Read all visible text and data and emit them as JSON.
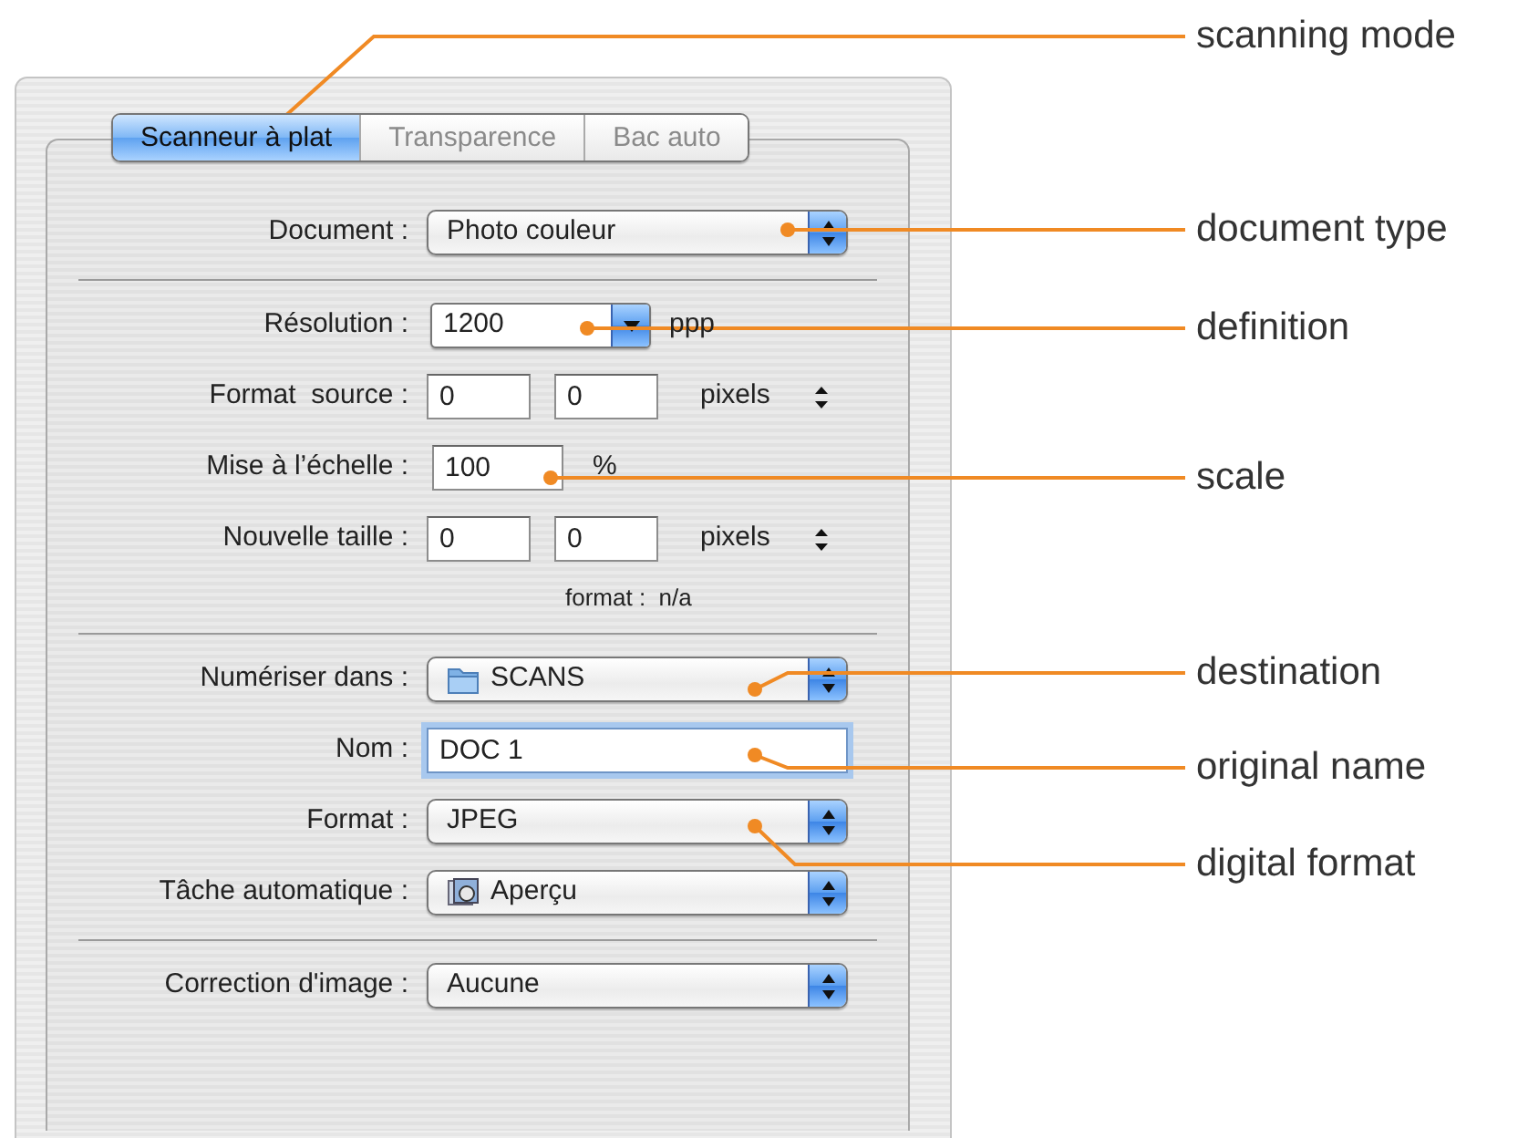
{
  "tabs": [
    {
      "label": "Scanneur à plat",
      "selected": true
    },
    {
      "label": "Transparence",
      "selected": false
    },
    {
      "label": "Bac auto",
      "selected": false
    }
  ],
  "rows": [
    {
      "kind": "popup",
      "label": "Document :",
      "value": "Photo couleur"
    },
    {
      "kind": "separator"
    },
    {
      "kind": "combo",
      "label": "Résolution :",
      "value": "1200",
      "unit": "ppp"
    },
    {
      "kind": "pair",
      "label": "Format  source :",
      "values": [
        "0",
        "0"
      ],
      "unit": "pixels"
    },
    {
      "kind": "field",
      "label": "Mise à l’échelle :",
      "value": "100",
      "unit": "%"
    },
    {
      "kind": "pair",
      "label": "Nouvelle taille :",
      "values": [
        "0",
        "0"
      ],
      "unit": "pixels"
    },
    {
      "kind": "note",
      "label": "format :",
      "value": "n/a"
    },
    {
      "kind": "separator"
    },
    {
      "kind": "popup",
      "label": "Numériser dans :",
      "value": "SCANS"
    },
    {
      "kind": "text",
      "label": "Nom :",
      "value": "DOC 1",
      "focused": true
    },
    {
      "kind": "popup",
      "label": "Format :",
      "value": "JPEG"
    },
    {
      "kind": "popup",
      "label": "Tâche automatique :",
      "value": "Aperçu"
    },
    {
      "kind": "separator"
    },
    {
      "kind": "popup",
      "label": "Correction d'image :",
      "value": "Aucune"
    }
  ],
  "callouts": [
    {
      "label": "scanning mode"
    },
    {
      "label": "document type"
    },
    {
      "label": "definition"
    },
    {
      "label": "scale"
    },
    {
      "label": "destination"
    },
    {
      "label": "original name"
    },
    {
      "label": "digital format"
    }
  ]
}
